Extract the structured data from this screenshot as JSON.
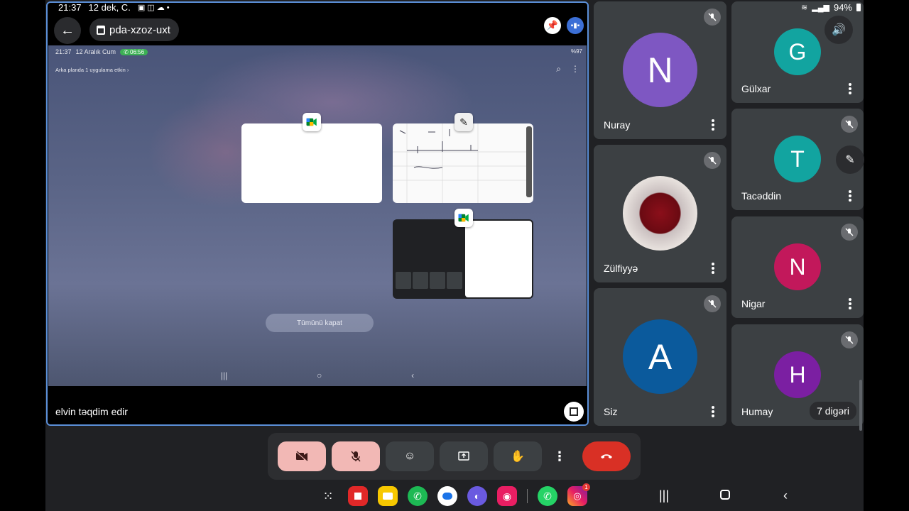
{
  "status_bar": {
    "time": "21:37",
    "date": "12 dek, C.",
    "battery": "94%"
  },
  "meeting": {
    "code": "pda-xzoz-uxt"
  },
  "presentation": {
    "presenter_label": "elvin təqdim edir",
    "inner_screen": {
      "time": "21:37",
      "date": "12 Aralık Cum",
      "call_timer": "06:56",
      "battery": "%97",
      "background_note": "Arka planda 1 uygulama etkin",
      "close_all_label": "Tümünü kapat"
    }
  },
  "participants": [
    {
      "name": "Nuray",
      "initial": "N",
      "color": "#7e57c2"
    },
    {
      "name": "Gülxar",
      "initial": "G",
      "color": "#12a4a0"
    },
    {
      "name": "Zülfiyyə",
      "initial": "",
      "color": "#b71c1c"
    },
    {
      "name": "Tacəddin",
      "initial": "T",
      "color": "#12a4a0"
    },
    {
      "name": "Nigar",
      "initial": "N",
      "color": "#c2185b"
    },
    {
      "name": "Siz",
      "initial": "A",
      "color": "#0b5a9c"
    },
    {
      "name": "Humay",
      "initial": "H",
      "color": "#7b1fa2"
    }
  ],
  "others_count_label": "7 digəri",
  "controls": {
    "camera": "camera-off-icon",
    "mic": "mic-off-icon",
    "reactions": "emoji-icon",
    "present": "present-screen-icon",
    "raise_hand": "hand-icon",
    "more": "more-vert-icon",
    "leave": "call-end-icon"
  },
  "dock_apps": [
    "apps-grid",
    "flipboard",
    "notes",
    "phone",
    "messages",
    "browser",
    "camera",
    "whatsapp",
    "instagram"
  ],
  "instagram_badge": "1",
  "colors": {
    "accent_border": "#5b8fd8",
    "leave": "#d93025",
    "muted_toggle": "#f2b8b5"
  }
}
